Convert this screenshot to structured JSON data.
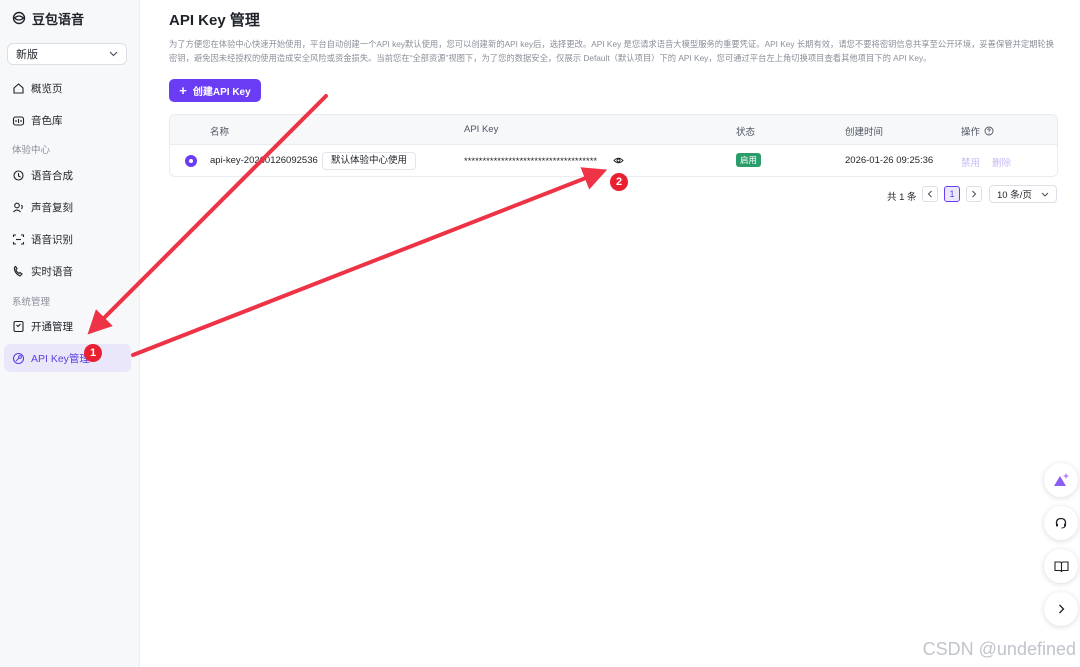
{
  "brand": {
    "name": "豆包语音"
  },
  "version_select": {
    "value": "新版"
  },
  "sidebar": {
    "items": [
      {
        "label": "概览页",
        "icon": "home-icon"
      },
      {
        "label": "音色库",
        "icon": "voice-library-icon"
      },
      {
        "group": "体验中心"
      },
      {
        "label": "语音合成",
        "icon": "speech-synthesis-icon"
      },
      {
        "label": "声音复刻",
        "icon": "voice-clone-icon"
      },
      {
        "label": "语音识别",
        "icon": "speech-recognition-icon"
      },
      {
        "label": "实时语音",
        "icon": "realtime-voice-icon"
      },
      {
        "group": "系统管理"
      },
      {
        "label": "开通管理",
        "icon": "activation-icon"
      },
      {
        "label": "API Key管理",
        "icon": "key-icon",
        "active": true
      }
    ]
  },
  "main": {
    "title": "API Key 管理",
    "description": "为了方便您在体验中心快速开始使用，平台自动创建一个API key默认使用，您可以创建新的API key后，选择更改。API Key 是您请求语音大模型服务的重要凭证。API Key 长期有效，请您不要将密钥信息共享至公开环境，妥善保管并定期轮换密钥，避免因未经授权的使用造成安全风险或资金损失。当前您在“全部资源”视图下，为了您的数据安全，仅展示 Default（默认项目）下的 API Key，您可通过平台左上角切换项目查看其他项目下的 API Key。",
    "create_button": "创建API Key"
  },
  "table": {
    "columns": [
      "名称",
      "API Key",
      "状态",
      "创建时间",
      "操作"
    ],
    "rows": [
      {
        "selected": true,
        "name": "api-key-20260126092536",
        "tag": "默认体验中心使用",
        "key_masked": "************************************",
        "status": "启用",
        "created": "2026-01-26 09:25:36",
        "actions": [
          "禁用",
          "删除"
        ]
      }
    ]
  },
  "pagination": {
    "total": "共 1 条",
    "current": "1",
    "page_size": "10 条/页"
  },
  "annotations": {
    "badge1": "1",
    "badge2": "2"
  },
  "watermark": "CSDN @undefined",
  "colors": {
    "accent": "#6a3df5",
    "status_green": "#2a9d6a",
    "annotation_red": "#e8202f"
  }
}
